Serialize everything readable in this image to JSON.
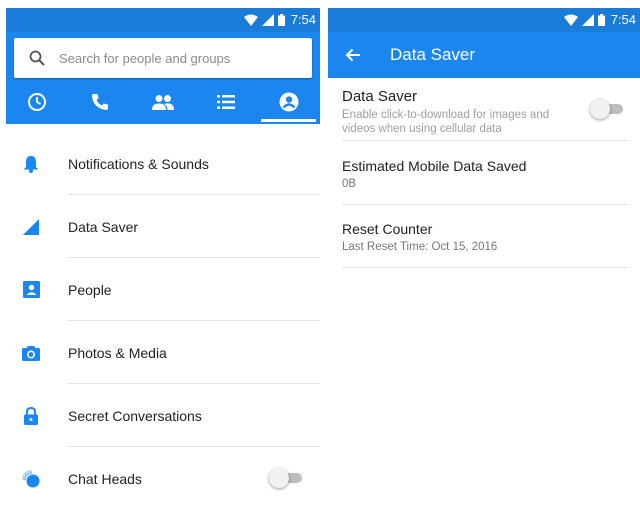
{
  "status_bar": {
    "time": "7:54"
  },
  "left_screen": {
    "search": {
      "placeholder": "Search for people and groups"
    },
    "tabs": [
      {
        "icon": "clock-icon",
        "active": false
      },
      {
        "icon": "phone-icon",
        "active": false
      },
      {
        "icon": "people-icon",
        "active": false
      },
      {
        "icon": "list-icon",
        "active": false
      },
      {
        "icon": "profile-icon",
        "active": true
      }
    ],
    "menu": [
      {
        "icon": "bell-icon",
        "label": "Notifications & Sounds"
      },
      {
        "icon": "signal-icon",
        "label": "Data Saver"
      },
      {
        "icon": "contact-card-icon",
        "label": "People"
      },
      {
        "icon": "camera-icon",
        "label": "Photos & Media"
      },
      {
        "icon": "lock-icon",
        "label": "Secret Conversations"
      },
      {
        "icon": "chat-heads-icon",
        "label": "Chat Heads",
        "toggle": "off"
      }
    ]
  },
  "right_screen": {
    "title": "Data Saver",
    "settings": {
      "data_saver": {
        "title": "Data Saver",
        "subtitle": "Enable click-to-download for images and videos when using cellular data",
        "toggle": "off"
      },
      "estimated": {
        "title": "Estimated Mobile Data Saved",
        "value": "0B"
      },
      "reset": {
        "title": "Reset Counter",
        "subtitle": "Last Reset Time: Oct 15, 2016"
      }
    }
  },
  "colors": {
    "header_blue": "#1b86f0",
    "status_blue": "#1a7bd9",
    "icon_blue": "#1b86f0",
    "toggle_off": "#bdbdbd"
  }
}
